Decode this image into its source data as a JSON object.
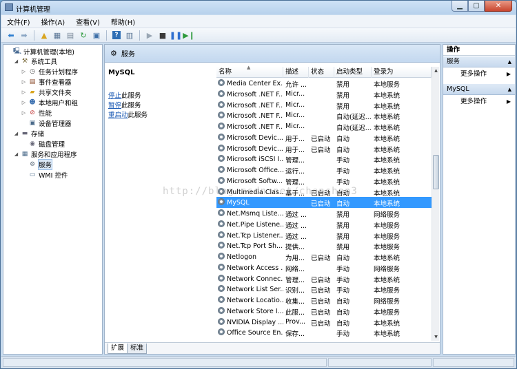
{
  "window": {
    "title": "计算机管理"
  },
  "menu": [
    "文件(F)",
    "操作(A)",
    "查看(V)",
    "帮助(H)"
  ],
  "tree": [
    {
      "label": "计算机管理(本地)",
      "level": 0,
      "expander": "",
      "icon": "computer-icon"
    },
    {
      "label": "系统工具",
      "level": 1,
      "expander": "◢",
      "icon": "tools-icon"
    },
    {
      "label": "任务计划程序",
      "level": 2,
      "expander": "▷",
      "icon": "clock-icon"
    },
    {
      "label": "事件查看器",
      "level": 2,
      "expander": "▷",
      "icon": "event-viewer-icon"
    },
    {
      "label": "共享文件夹",
      "level": 2,
      "expander": "▷",
      "icon": "shared-folder-icon"
    },
    {
      "label": "本地用户和组",
      "level": 2,
      "expander": "▷",
      "icon": "users-icon"
    },
    {
      "label": "性能",
      "level": 2,
      "expander": "▷",
      "icon": "performance-icon"
    },
    {
      "label": "设备管理器",
      "level": 2,
      "expander": "",
      "icon": "device-manager-icon"
    },
    {
      "label": "存储",
      "level": 1,
      "expander": "◢",
      "icon": "storage-icon"
    },
    {
      "label": "磁盘管理",
      "level": 2,
      "expander": "",
      "icon": "disk-icon"
    },
    {
      "label": "服务和应用程序",
      "level": 1,
      "expander": "◢",
      "icon": "services-apps-icon"
    },
    {
      "label": "服务",
      "level": 2,
      "expander": "",
      "icon": "services-icon",
      "selected": true
    },
    {
      "label": "WMI 控件",
      "level": 2,
      "expander": "",
      "icon": "wmi-icon"
    }
  ],
  "mid": {
    "header": "服务",
    "detail_title": "MySQL",
    "actions": [
      {
        "link": "停止",
        "rest": "此服务"
      },
      {
        "link": "暂停",
        "rest": "此服务"
      },
      {
        "link": "重启动",
        "rest": "此服务"
      }
    ],
    "columns": [
      "名称",
      "描述",
      "状态",
      "启动类型",
      "登录为"
    ],
    "tabs": [
      "扩展",
      "标准"
    ]
  },
  "services": [
    {
      "name": "Media Center Ex...",
      "desc": "允许 ...",
      "status": "",
      "startup": "禁用",
      "logon": "本地服务"
    },
    {
      "name": "Microsoft .NET F...",
      "desc": "Micr...",
      "status": "",
      "startup": "禁用",
      "logon": "本地系统"
    },
    {
      "name": "Microsoft .NET F...",
      "desc": "Micr...",
      "status": "",
      "startup": "禁用",
      "logon": "本地系统"
    },
    {
      "name": "Microsoft .NET F...",
      "desc": "Micr...",
      "status": "",
      "startup": "自动(延迟...",
      "logon": "本地系统"
    },
    {
      "name": "Microsoft .NET F...",
      "desc": "Micr...",
      "status": "",
      "startup": "自动(延迟...",
      "logon": "本地系统"
    },
    {
      "name": "Microsoft Devic...",
      "desc": "用于...",
      "status": "已启动",
      "startup": "自动",
      "logon": "本地系统"
    },
    {
      "name": "Microsoft Devic...",
      "desc": "用于...",
      "status": "已启动",
      "startup": "自动",
      "logon": "本地系统"
    },
    {
      "name": "Microsoft iSCSI I...",
      "desc": "管理...",
      "status": "",
      "startup": "手动",
      "logon": "本地系统"
    },
    {
      "name": "Microsoft Office...",
      "desc": "运行...",
      "status": "",
      "startup": "手动",
      "logon": "本地系统"
    },
    {
      "name": "Microsoft Softw...",
      "desc": "管理...",
      "status": "",
      "startup": "手动",
      "logon": "本地系统"
    },
    {
      "name": "Multimedia Clas...",
      "desc": "基于...",
      "status": "已启动",
      "startup": "自动",
      "logon": "本地系统"
    },
    {
      "name": "MySQL",
      "desc": "",
      "status": "已启动",
      "startup": "自动",
      "logon": "本地系统",
      "selected": true
    },
    {
      "name": "Net.Msmq Liste...",
      "desc": "通过 ...",
      "status": "",
      "startup": "禁用",
      "logon": "网络服务"
    },
    {
      "name": "Net.Pipe Listene...",
      "desc": "通过 ...",
      "status": "",
      "startup": "禁用",
      "logon": "本地服务"
    },
    {
      "name": "Net.Tcp Listener...",
      "desc": "通过 ...",
      "status": "",
      "startup": "禁用",
      "logon": "本地服务"
    },
    {
      "name": "Net.Tcp Port Sh...",
      "desc": "提供...",
      "status": "",
      "startup": "禁用",
      "logon": "本地服务"
    },
    {
      "name": "Netlogon",
      "desc": "为用...",
      "status": "已启动",
      "startup": "自动",
      "logon": "本地系统"
    },
    {
      "name": "Network Access ...",
      "desc": "网络...",
      "status": "",
      "startup": "手动",
      "logon": "网络服务"
    },
    {
      "name": "Network Connec...",
      "desc": "管理...",
      "status": "已启动",
      "startup": "手动",
      "logon": "本地系统"
    },
    {
      "name": "Network List Ser...",
      "desc": "识别...",
      "status": "已启动",
      "startup": "手动",
      "logon": "本地服务"
    },
    {
      "name": "Network Locatio...",
      "desc": "收集...",
      "status": "已启动",
      "startup": "自动",
      "logon": "网络服务"
    },
    {
      "name": "Network Store I...",
      "desc": "此服...",
      "status": "已启动",
      "startup": "自动",
      "logon": "本地服务"
    },
    {
      "name": "NVIDIA Display ...",
      "desc": "Prov...",
      "status": "已启动",
      "startup": "自动",
      "logon": "本地系统"
    },
    {
      "name": "Office Source En...",
      "desc": "保存...",
      "status": "",
      "startup": "手动",
      "logon": "本地系统"
    }
  ],
  "actions_pane": {
    "title": "操作",
    "sections": [
      {
        "head": "服务",
        "item": "更多操作"
      },
      {
        "head": "MySQL",
        "item": "更多操作"
      }
    ]
  },
  "watermark": "http://blog.csdn.net/chenshan3"
}
